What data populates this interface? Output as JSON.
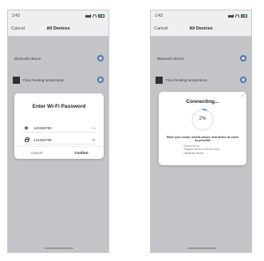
{
  "left_screen": {
    "status": {
      "time": "2:43"
    },
    "nav": {
      "cancel": "Cancel",
      "title": "All Devices"
    },
    "devices": [
      {
        "name": "Bluetooth device"
      },
      {
        "name": "Floor heating temperature"
      }
    ],
    "dialog": {
      "title": "Enter Wi-Fi Password",
      "ssid": "123456789",
      "ssid_action": "Re",
      "password": "123456789",
      "password_action": "👁",
      "cancel": "Cancel",
      "confirm": "Confirm"
    }
  },
  "right_screen": {
    "status": {
      "time": "1:43"
    },
    "nav": {
      "cancel": "Cancel",
      "title": "All Devices"
    },
    "devices": [
      {
        "name": "Bluetooth device"
      },
      {
        "name": "Floor heating temperature"
      }
    ],
    "dialog": {
      "title": "Connecting...",
      "progress": "2%",
      "progress_value": 0.02,
      "close": "×",
      "description": "Place your router, mobile phone, and device as close as possible",
      "steps": [
        "Device found",
        "Register device to Smart Cloud",
        "Initializing device"
      ]
    }
  },
  "colors": {
    "accent": "#4a7bd1",
    "screen_bg": "#e6e7ea",
    "dialog_bg": "#ffffff"
  },
  "icons": {
    "wifi": "wifi-icon",
    "lock": "lock-icon",
    "toggle": "toggle-icon",
    "close": "close-icon"
  }
}
